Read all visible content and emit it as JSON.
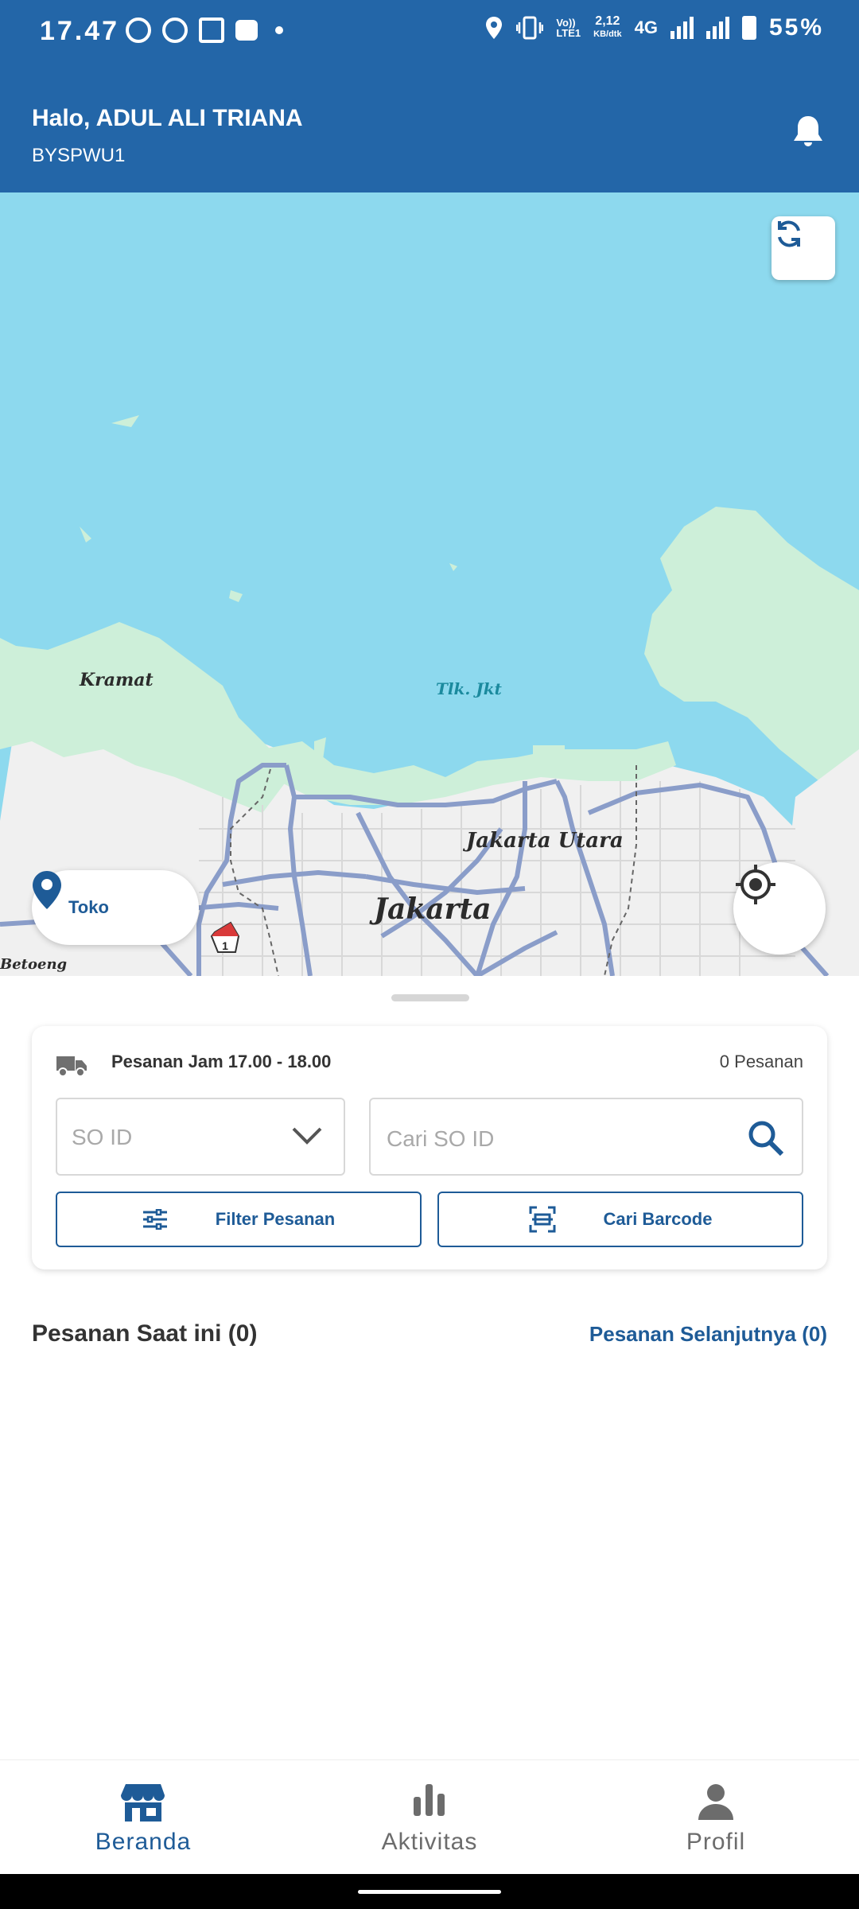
{
  "status_bar": {
    "time": "17.47",
    "data_speed": "2,12",
    "data_unit": "KB/dtk",
    "volte": "Vo))",
    "lte": "LTE1",
    "network": "4G",
    "battery": "55%"
  },
  "header": {
    "greeting": "Halo, ADUL ALI TRIANA",
    "code": "BYSPWU1"
  },
  "map": {
    "labels": {
      "kramat": "Kramat",
      "bay": "Tlk. Jkt",
      "north": "Jakarta Utara",
      "city": "Jakarta",
      "betoeng": "Betoeng",
      "route": "1"
    },
    "toko_label": "Toko"
  },
  "card": {
    "order_time": "Pesanan Jam 17.00 - 18.00",
    "order_count": "0 Pesanan",
    "so_select_label": "SO ID",
    "search_placeholder": "Cari SO ID",
    "filter_label": "Filter Pesanan",
    "barcode_label": "Cari Barcode"
  },
  "sections": {
    "current": "Pesanan Saat ini (0)",
    "next": "Pesanan Selanjutnya (0)"
  },
  "nav": {
    "items": [
      {
        "label": "Beranda",
        "icon": "store-icon",
        "active": true
      },
      {
        "label": "Aktivitas",
        "icon": "bar-chart-icon",
        "active": false
      },
      {
        "label": "Profil",
        "icon": "person-icon",
        "active": false
      }
    ]
  },
  "colors": {
    "primary": "#2366a8",
    "link": "#1e5b97",
    "sea": "#8dd9ee",
    "land_green": "#cdefd9",
    "land_grey": "#f2f2f2",
    "road": "#8a9dc9",
    "nav_inactive": "#6c6c6c"
  }
}
